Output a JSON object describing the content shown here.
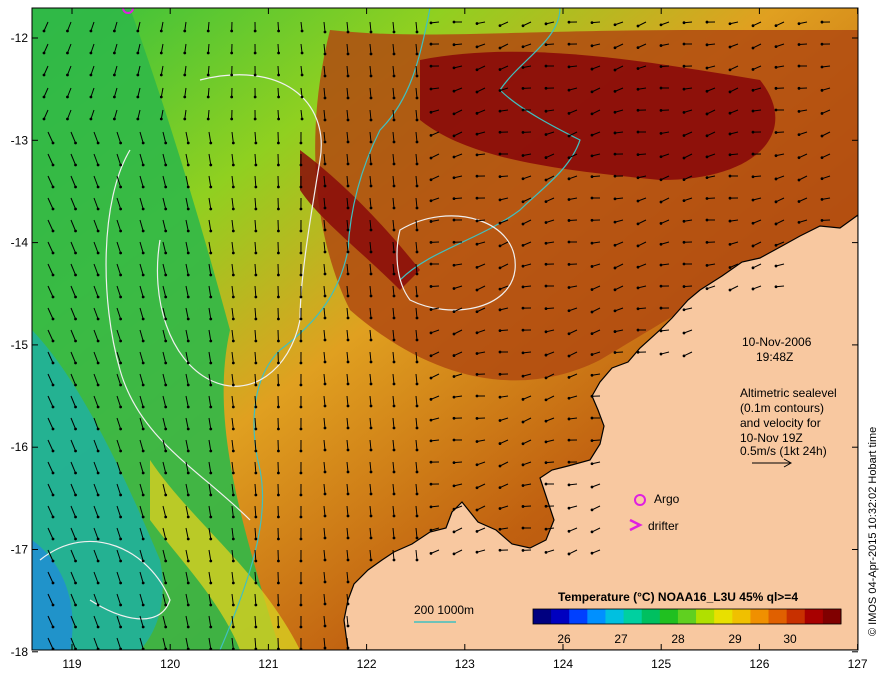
{
  "map": {
    "longitude_ticks": [
      "119",
      "120",
      "121",
      "122",
      "123",
      "124",
      "125",
      "126",
      "127"
    ],
    "latitude_ticks": [
      "-12",
      "-13",
      "-14",
      "-15",
      "-16",
      "-17",
      "-18"
    ]
  },
  "annotation": {
    "date": "10-Nov-2006",
    "time": "19:48Z",
    "altimetry_lines": [
      "Altimetric sealevel",
      "(0.1m contours)",
      "and velocity for",
      "10-Nov 19Z",
      "0.5m/s (1kt 24h)"
    ]
  },
  "legend": {
    "argo_label": "Argo",
    "drifter_label": "drifter",
    "bathymetry_label": "200  1000m",
    "argo_color": "#e020e0",
    "drifter_color": "#e020e0",
    "bathymetry_color": "#40c0c0"
  },
  "colorbar": {
    "title": "Temperature (°C) NOAA16_L3U 45% ql>=4",
    "tick_labels": [
      "26",
      "27",
      "28",
      "29",
      "30"
    ],
    "colors": [
      "#000080",
      "#0000c0",
      "#0040ff",
      "#0090ff",
      "#00c0e0",
      "#00d0a0",
      "#00c060",
      "#20c020",
      "#60d020",
      "#b0e000",
      "#e8e000",
      "#f0c000",
      "#f09000",
      "#e06000",
      "#c83000",
      "#a80000",
      "#800000"
    ]
  },
  "credit": "© IMOS 04-Apr-2015 10:32:02 Hobart time"
}
